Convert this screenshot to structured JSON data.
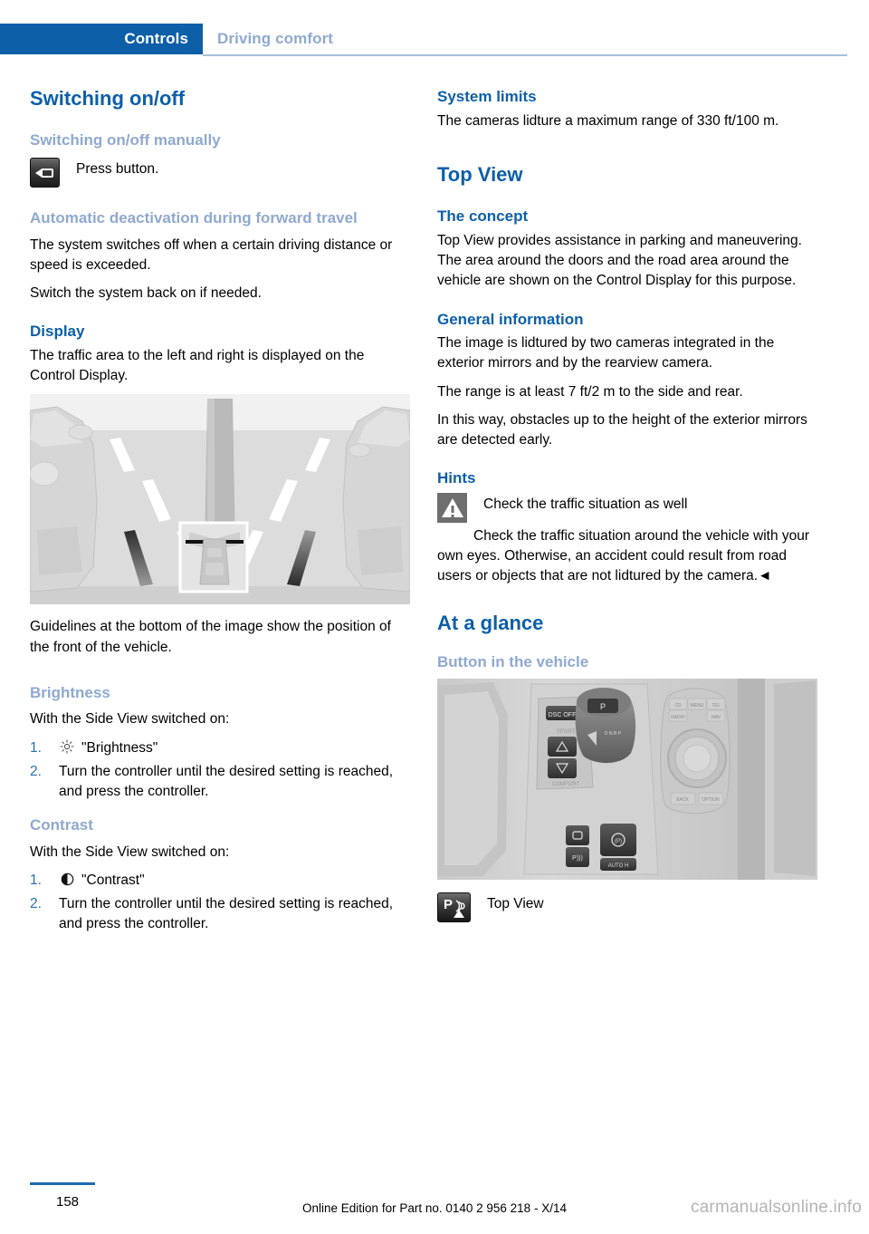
{
  "header": {
    "active_tab": "Controls",
    "inactive_tab": "Driving comfort",
    "accent_color": "#0d5fa8",
    "muted_color": "#8fa9d0"
  },
  "left_column": {
    "title": "Switching on/off",
    "manual_heading": "Switching on/off manually",
    "press_button_text": "Press button.",
    "press_button_icon": "camera-button-icon",
    "auto_deactivation_heading": "Automatic deactivation during forward travel",
    "auto_deactivation_p1": "The system switches off when a certain driving distance or speed is exceeded.",
    "auto_deactivation_p2": "Switch the system back on if needed.",
    "display_heading": "Display",
    "display_p1": "The traffic area to the left and right is displayed on the Control Display.",
    "figure_sideview_alt": "Side View camera illustration showing the traffic area to the left and right with guidelines",
    "display_caption": "Guidelines at the bottom of the image show the position of the front of the vehicle.",
    "brightness_heading": "Brightness",
    "brightness_intro": "With the Side View switched on:",
    "brightness_steps": [
      {
        "num": "1.",
        "icon": "sun-icon",
        "text": "\"Brightness\""
      },
      {
        "num": "2.",
        "icon": "",
        "text": "Turn the controller until the desired setting is reached, and press the controller."
      }
    ],
    "contrast_heading": "Contrast",
    "contrast_intro": "With the Side View switched on:",
    "contrast_steps": [
      {
        "num": "1.",
        "icon": "contrast-icon",
        "text": "\"Contrast\""
      },
      {
        "num": "2.",
        "icon": "",
        "text": "Turn the controller until the desired setting is reached, and press the controller."
      }
    ]
  },
  "right_column": {
    "system_limits_heading": "System limits",
    "system_limits_p1": "The cameras lidture a maximum range of 330 ft/100 m.",
    "top_view_title": "Top View",
    "concept_heading": "The concept",
    "concept_p1": "Top View provides assistance in parking and maneuvering. The area around the doors and the road area around the vehicle are shown on the Control Display for this purpose.",
    "general_info_heading": "General information",
    "general_info_p1": "The image is lidtured by two cameras integrated in the exterior mirrors and by the rearview camera.",
    "general_info_p2": "The range is at least 7 ft/2 m to the side and rear.",
    "general_info_p3": "In this way, obstacles up to the height of the exterior mirrors are detected early.",
    "hints_heading": "Hints",
    "warning_icon": "warning-triangle-icon",
    "warning_title": "Check the traffic situation as well",
    "warning_body": "Check the traffic situation around the vehicle with your own eyes. Otherwise, an accident could result from road users or objects that are not lidtured by the camera.◄",
    "at_a_glance_heading": "At a glance",
    "button_in_vehicle_heading": "Button in the vehicle",
    "figure_console_alt": "Photo of the vehicle center console with gear selector, driving experience buttons, and iDrive controller",
    "top_view_button_icon": "pdc-top-view-icon",
    "top_view_button_label": "Top View"
  },
  "footer": {
    "page_number": "158",
    "edition_note": "Online Edition for Part no. 0140 2 956 218 - X/14",
    "watermark": "carmanualsonline.info"
  }
}
